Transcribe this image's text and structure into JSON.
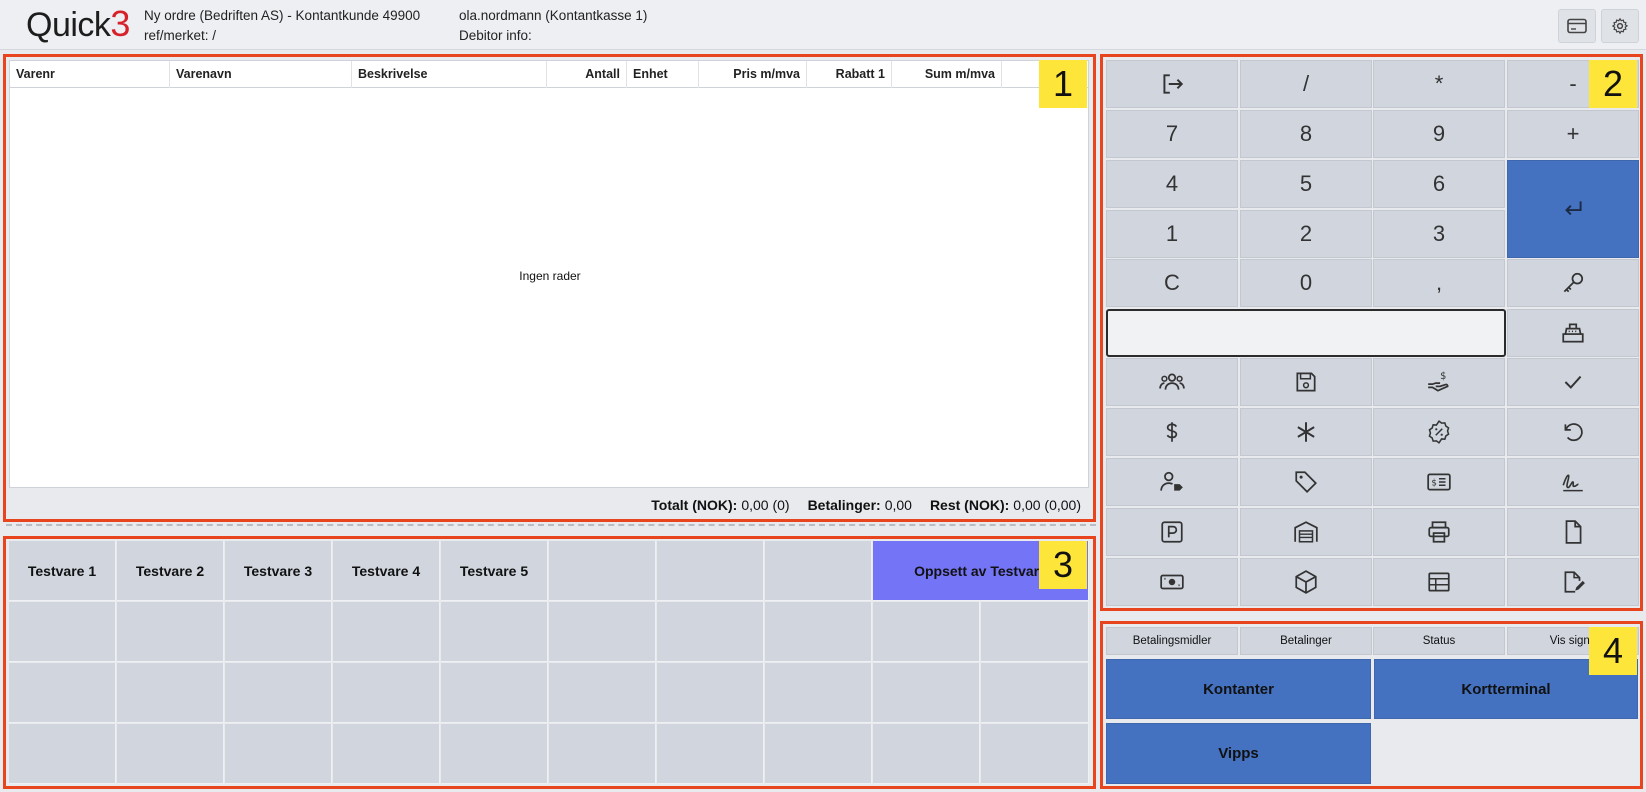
{
  "header": {
    "logo_text": "Quick",
    "logo_num": "3",
    "order_line": "Ny ordre (Bedriften AS) - Kontantkunde 49900",
    "ref_line": "ref/merket: /",
    "user_line": "ola.nordmann (Kontantkasse 1)",
    "debitor_line": "Debitor info:"
  },
  "badges": [
    "1",
    "2",
    "3",
    "4"
  ],
  "order_table": {
    "columns": [
      "Varenr",
      "Varenavn",
      "Beskrivelse",
      "Antall",
      "Enhet",
      "Pris m/mva",
      "Rabatt 1",
      "Sum m/mva"
    ],
    "empty_message": "Ingen rader"
  },
  "totals": {
    "total_label": "Totalt (NOK):",
    "total_value": "0,00 (0)",
    "payments_label": "Betalinger:",
    "payments_value": "0,00",
    "rest_label": "Rest (NOK):",
    "rest_value": "0,00 (0,00)"
  },
  "numpad": {
    "divide": "/",
    "multiply": "*",
    "minus": "-",
    "plus": "+",
    "seven": "7",
    "eight": "8",
    "nine": "9",
    "four": "4",
    "five": "5",
    "six": "6",
    "one": "1",
    "two": "2",
    "three": "3",
    "clear": "C",
    "zero": "0",
    "comma": ",",
    "input_value": ""
  },
  "products": [
    "Testvare 1",
    "Testvare 2",
    "Testvare 3",
    "Testvare 4",
    "Testvare 5",
    "",
    "",
    "",
    "Oppsett av Testvare"
  ],
  "payment": {
    "tabs": [
      "Betalingsmidler",
      "Betalinger",
      "Status",
      "Vis signa"
    ],
    "cash": "Kontanter",
    "card": "Kortterminal",
    "vipps": "Vipps"
  },
  "colors": {
    "accent_blue": "#4472c1",
    "active_product": "#7474f6",
    "region_border": "#e8451f",
    "badge_yellow": "#fde53a"
  }
}
